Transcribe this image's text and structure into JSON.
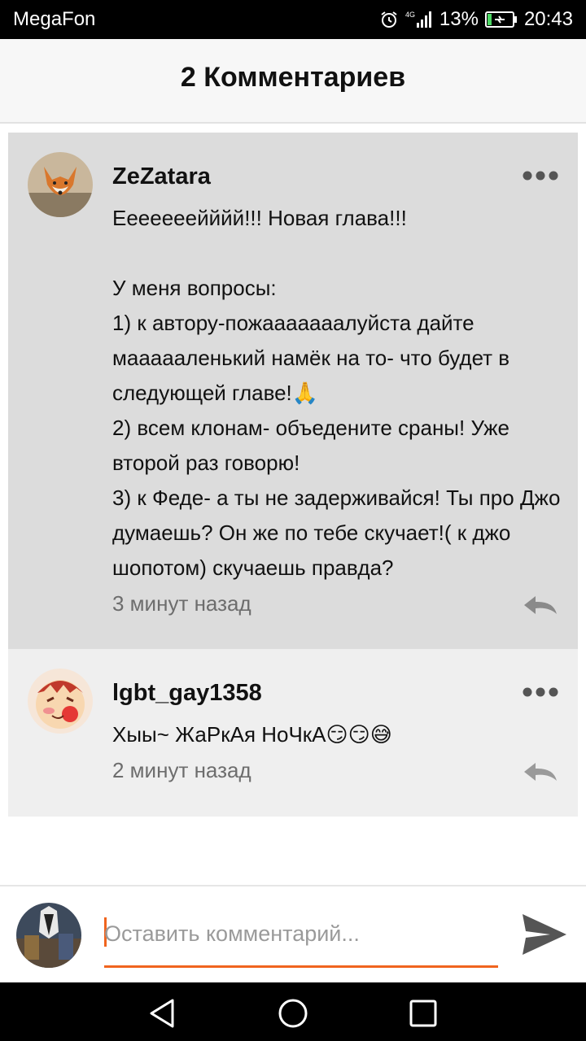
{
  "status_bar": {
    "carrier": "MegaFon",
    "network": "4G",
    "battery": "13%",
    "time": "20:43"
  },
  "header": {
    "title": "2 Комментариев"
  },
  "comments": [
    {
      "username": "ZeZatara",
      "text": "Ееееееейййй!!! Новая глава!!!\n\nУ меня вопросы:\n1) к автору-пожааааааалуйста дайте маааааленький намёк на то- что будет в следующей главе!🙏\n2) всем клонам- объедените сраны! Уже второй раз говорю!\n3) к Феде- а ты не задерживайся! Ты про Джо думаешь? Он же по тебе скучает!( к джо шопотом) скучаешь правда?",
      "time": "3 минут назад",
      "avatar_icon": "fox-avatar"
    },
    {
      "username": "lgbt_gay1358",
      "text": "Хыы~ ЖаРкАя НоЧкА😏😏😅",
      "time": "2 минут назад",
      "avatar_icon": "blushing-face-avatar"
    }
  ],
  "compose": {
    "placeholder": "Оставить комментарий..."
  },
  "colors": {
    "accent": "#f0641e",
    "comment_bg_active": "#dcdcdc",
    "comment_bg": "#efefef"
  }
}
